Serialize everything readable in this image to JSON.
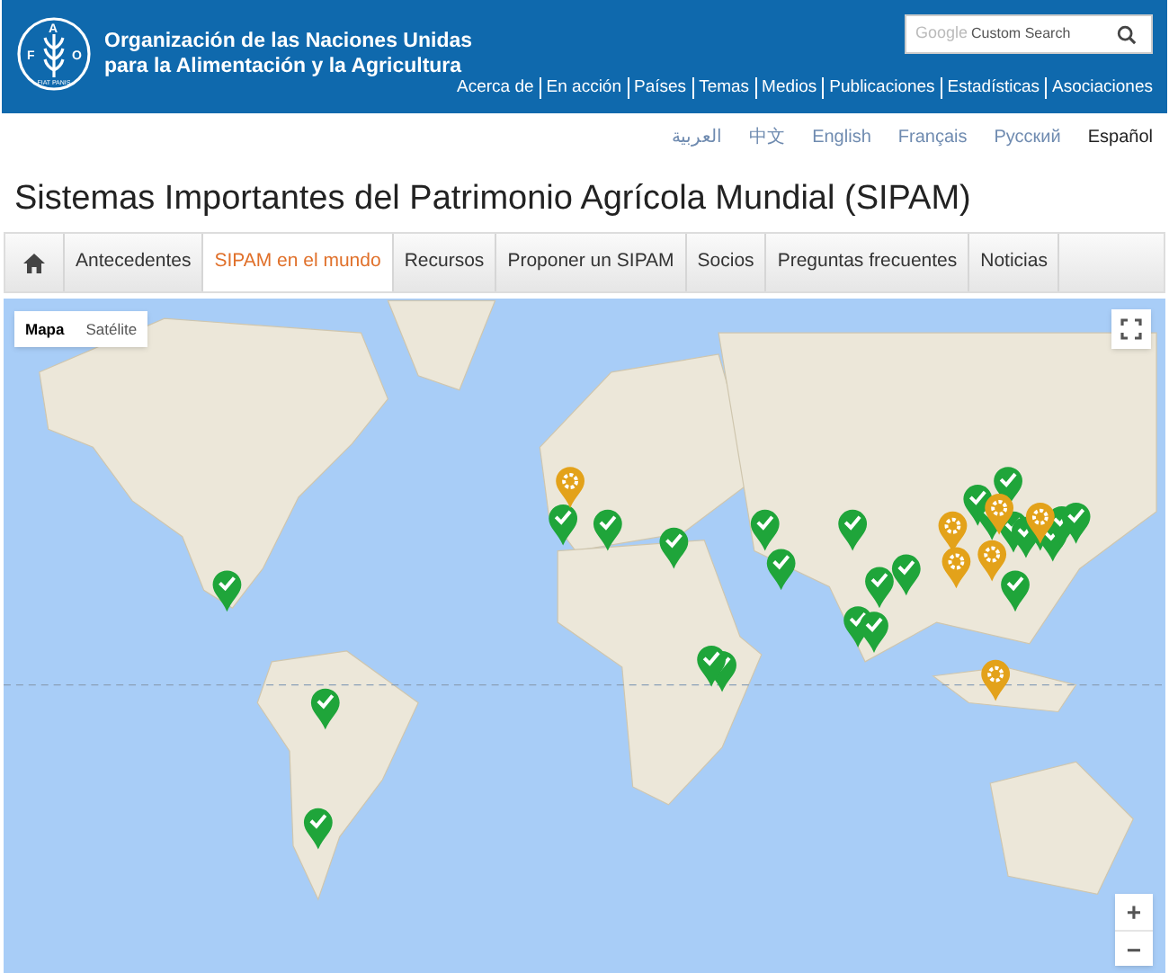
{
  "header": {
    "logo": {
      "letters": [
        "F",
        "A",
        "O"
      ],
      "motto": "FIAT PANIS"
    },
    "org_name": [
      "Organización de las Naciones Unidas",
      "para la Alimentación y la Agricultura"
    ],
    "search": {
      "brand": "Google",
      "placeholder": "Custom Search"
    },
    "nav_links": [
      "Acerca de",
      "En acción",
      "Países",
      "Temas",
      "Medios",
      "Publicaciones",
      "Estadísticas",
      "Asociaciones"
    ]
  },
  "languages": [
    {
      "label": "العربية",
      "selected": false
    },
    {
      "label": "中文",
      "selected": false
    },
    {
      "label": "English",
      "selected": false
    },
    {
      "label": "Français",
      "selected": false
    },
    {
      "label": "Русский",
      "selected": false
    },
    {
      "label": "Español",
      "selected": true
    }
  ],
  "page_title": "Sistemas Importantes del Patrimonio Agrícola Mundial (SIPAM)",
  "tabs": [
    {
      "kind": "home",
      "selected": false
    },
    {
      "kind": "text",
      "label": "Antecedentes",
      "selected": false
    },
    {
      "kind": "text",
      "label": "SIPAM en el mundo",
      "selected": true
    },
    {
      "kind": "text",
      "label": "Recursos",
      "selected": false
    },
    {
      "kind": "text",
      "label": "Proponer un SIPAM",
      "selected": false
    },
    {
      "kind": "text",
      "label": "Socios",
      "selected": false
    },
    {
      "kind": "text",
      "label": "Preguntas frecuentes",
      "selected": false
    },
    {
      "kind": "text",
      "label": "Noticias",
      "selected": false
    }
  ],
  "map": {
    "map_types": [
      {
        "label": "Mapa",
        "selected": true
      },
      {
        "label": "Satélite",
        "selected": false
      }
    ],
    "zoom": [
      "+",
      "−"
    ]
  }
}
